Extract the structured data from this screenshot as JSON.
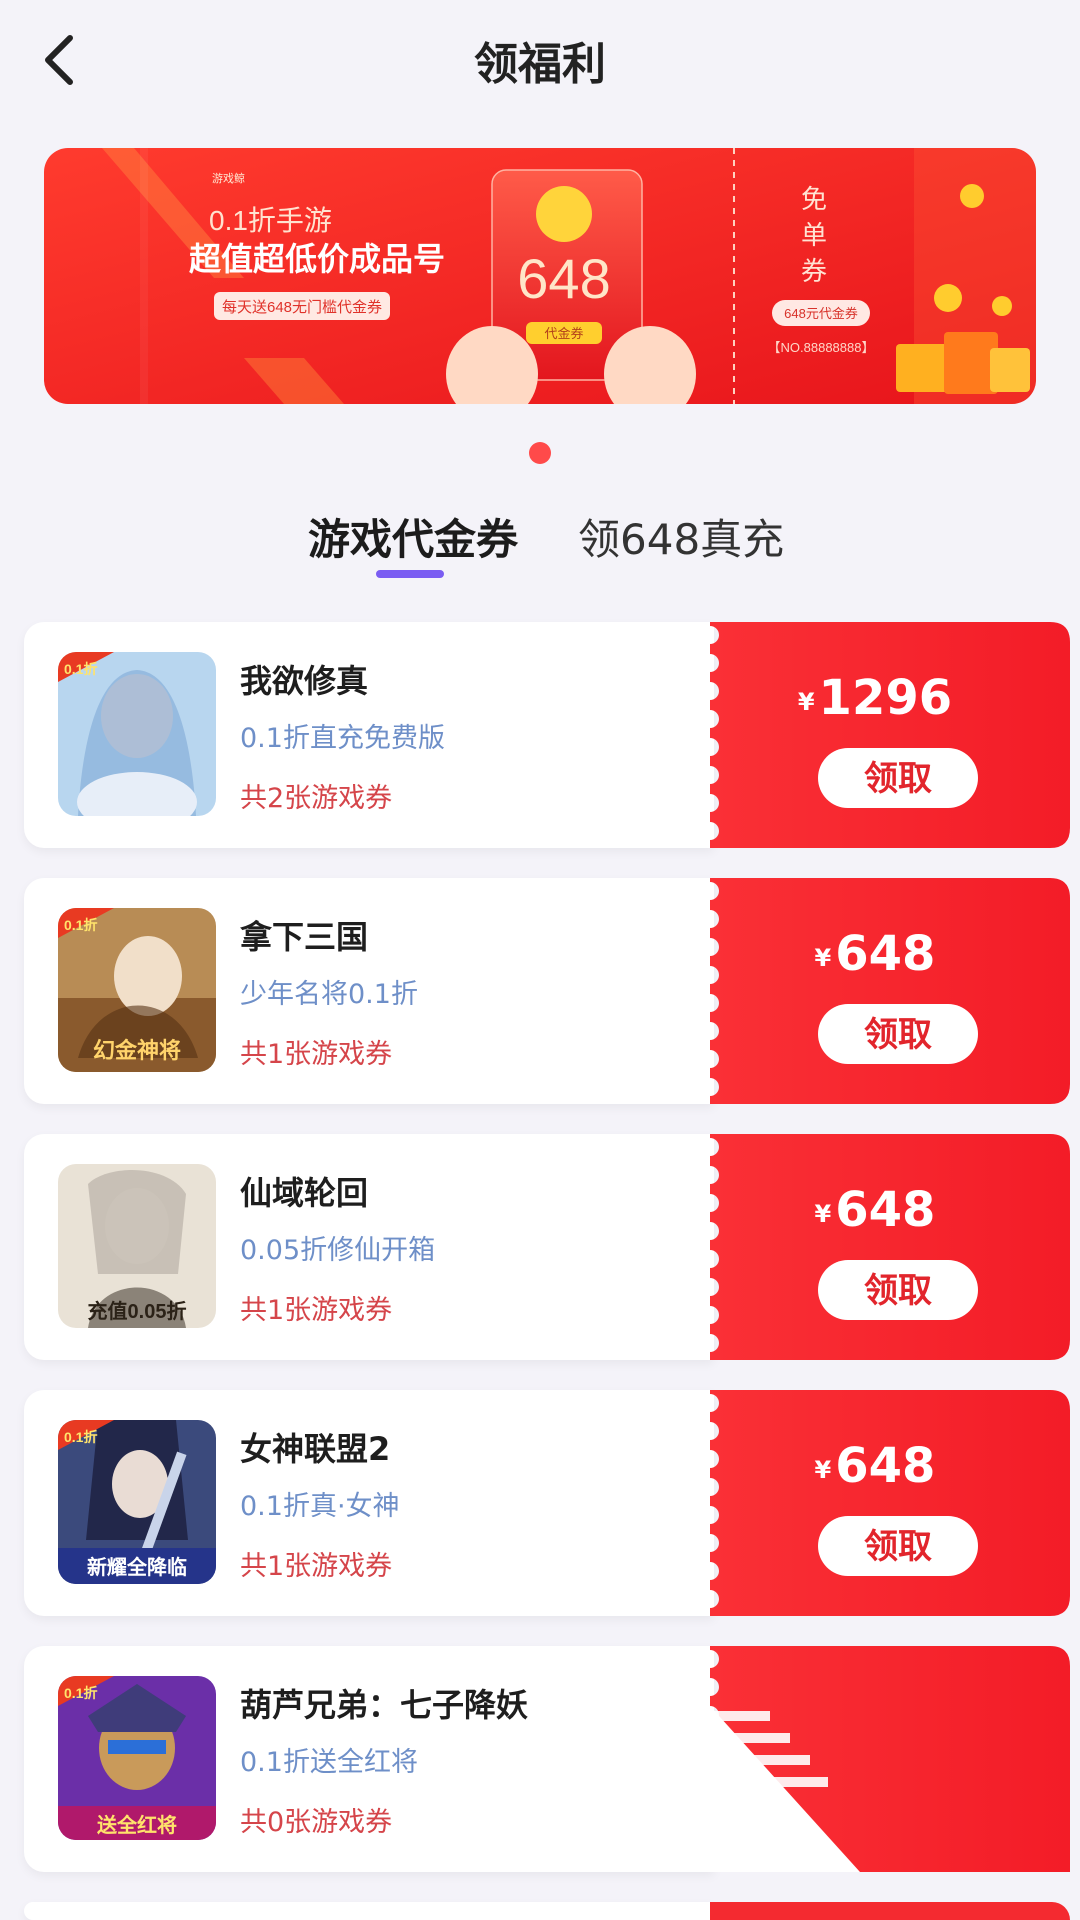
{
  "header": {
    "title": "领福利"
  },
  "banner": {
    "line1": "0.1折手游",
    "line2": "超值超低价成品号",
    "line3": "每天送648无门槛代金券",
    "packet_amount": "648",
    "packet_label": "代金券",
    "ticket_title": [
      "免",
      "单",
      "券"
    ],
    "ticket_value": "648元代金券",
    "ticket_no": "【NO.88888888】"
  },
  "tabs": [
    {
      "label": "游戏代金券",
      "active": true
    },
    {
      "label": "领648真充",
      "active": false
    }
  ],
  "claim_label": "领取",
  "currency": "¥",
  "games": [
    {
      "name": "我欲修真",
      "desc": "0.1折直充免费版",
      "count": "共2张游戏券",
      "price": "1296",
      "badge": "0.1折"
    },
    {
      "name": "拿下三国",
      "desc": "少年名将0.1折",
      "count": "共1张游戏券",
      "price": "648",
      "badge": "0.1折",
      "art": "幻金神将"
    },
    {
      "name": "仙域轮回",
      "desc": "0.05折修仙开箱",
      "count": "共1张游戏券",
      "price": "648",
      "art": "充值0.05折"
    },
    {
      "name": "女神联盟2",
      "desc": "0.1折真·女神",
      "count": "共1张游戏券",
      "price": "648",
      "badge": "0.1折",
      "art": "新耀全降临"
    },
    {
      "name": "葫芦兄弟：七子降妖",
      "desc": "0.1折送全红将",
      "count": "共0张游戏券",
      "badge": "0.1折",
      "art": "送全红将"
    }
  ],
  "colors": {
    "accent_red": "#f42a30",
    "tab_underline": "#7a5cf2",
    "desc_blue": "#6e8fc8",
    "count_red": "#d5454a"
  }
}
